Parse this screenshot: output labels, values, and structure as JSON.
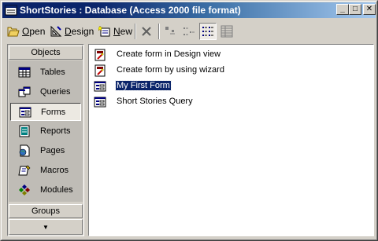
{
  "window": {
    "title": "ShortStories : Database (Access 2000 file format)",
    "controls": {
      "minimize": "_",
      "maximize": "□",
      "close": "✕"
    }
  },
  "toolbar": {
    "open": {
      "prefix": "",
      "hotkey": "O",
      "suffix": "pen",
      "icon": "open-icon"
    },
    "design": {
      "prefix": "",
      "hotkey": "D",
      "suffix": "esign",
      "icon": "design-icon"
    },
    "new": {
      "prefix": "",
      "hotkey": "N",
      "suffix": "ew",
      "icon": "new-icon"
    },
    "delete_icon": "delete-icon",
    "views": [
      "large-icons-view",
      "small-icons-view",
      "list-view",
      "details-view"
    ],
    "pressed_view": "list-view"
  },
  "sidebar": {
    "header": "Objects",
    "items": [
      {
        "label": "Tables",
        "icon": "table-icon",
        "selected": false
      },
      {
        "label": "Queries",
        "icon": "query-icon",
        "selected": false
      },
      {
        "label": "Forms",
        "icon": "form-icon",
        "selected": true
      },
      {
        "label": "Reports",
        "icon": "report-icon",
        "selected": false
      },
      {
        "label": "Pages",
        "icon": "page-icon",
        "selected": false
      },
      {
        "label": "Macros",
        "icon": "macro-icon",
        "selected": false
      },
      {
        "label": "Modules",
        "icon": "module-icon",
        "selected": false
      }
    ],
    "groups": "Groups",
    "scroll_glyph": "▼"
  },
  "list": {
    "items": [
      {
        "label": "Create form in Design view",
        "icon": "wizard-icon",
        "selected": false
      },
      {
        "label": "Create form by using wizard",
        "icon": "wizard-icon",
        "selected": false
      },
      {
        "label": "My First Form",
        "icon": "form-icon",
        "selected": true
      },
      {
        "label": "Short Stories Query",
        "icon": "form-icon",
        "selected": false
      }
    ]
  },
  "colors": {
    "titlebar_start": "#0a246a",
    "titlebar_end": "#a6caf0",
    "selection": "#0a246a",
    "face": "#d4d0c8"
  }
}
